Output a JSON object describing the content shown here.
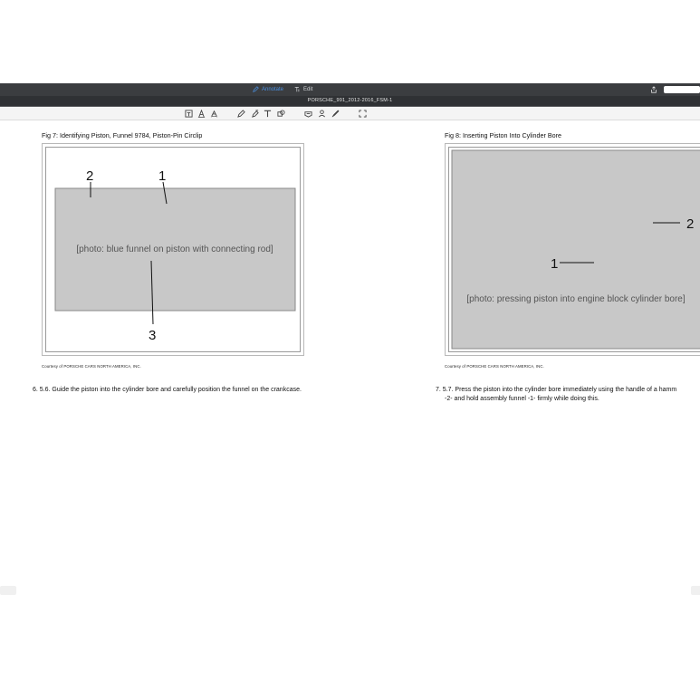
{
  "toolbar": {
    "mode_tabs": [
      {
        "label": "Annotate",
        "icon": "pen-icon",
        "active": true
      },
      {
        "label": "Edit",
        "icon": "text-cursor-icon",
        "active": false
      }
    ],
    "accent_color": "#4a90e2"
  },
  "document": {
    "title": "PORSCHE_991_2012-2016_FSM-1"
  },
  "annotation_tools": [
    {
      "name": "text-box-tool-icon"
    },
    {
      "name": "text-size-tool-icon"
    },
    {
      "name": "text-style-tool-icon"
    },
    {
      "name": "pencil-tool-icon"
    },
    {
      "name": "highlighter-tool-icon"
    },
    {
      "name": "text-tool-icon"
    },
    {
      "name": "shape-tool-icon"
    },
    {
      "name": "stamp-tool-icon"
    },
    {
      "name": "signature-tool-icon"
    },
    {
      "name": "fullscreen-icon"
    }
  ],
  "page_left": {
    "figure_title": "Fig 7: Identifying Piston, Funnel 9784, Piston-Pin Circlip",
    "image_label": "[photo: blue funnel on piston with connecting rod]",
    "callouts": [
      "2",
      "1",
      "3"
    ],
    "courtesy": "Courtesy of PORSCHE CARS NORTH AMERICA, INC.",
    "step_number": "6.",
    "step_text": "5.6. Guide the piston into the cylinder bore and carefully position the funnel on the crankcase."
  },
  "page_right": {
    "figure_title": "Fig 8: Inserting Piston Into Cylinder Bore",
    "image_label": "[photo: pressing piston into engine block cylinder bore]",
    "callouts": [
      "2",
      "1"
    ],
    "courtesy": "Courtesy of PORSCHE CARS NORTH AMERICA, INC.",
    "step_number": "7.",
    "step_line1": "5.7. Press the piston into the cylinder bore immediately using the handle of a hamm",
    "step_line2": "-2-  and hold assembly funnel -1-  firmly while doing this."
  }
}
